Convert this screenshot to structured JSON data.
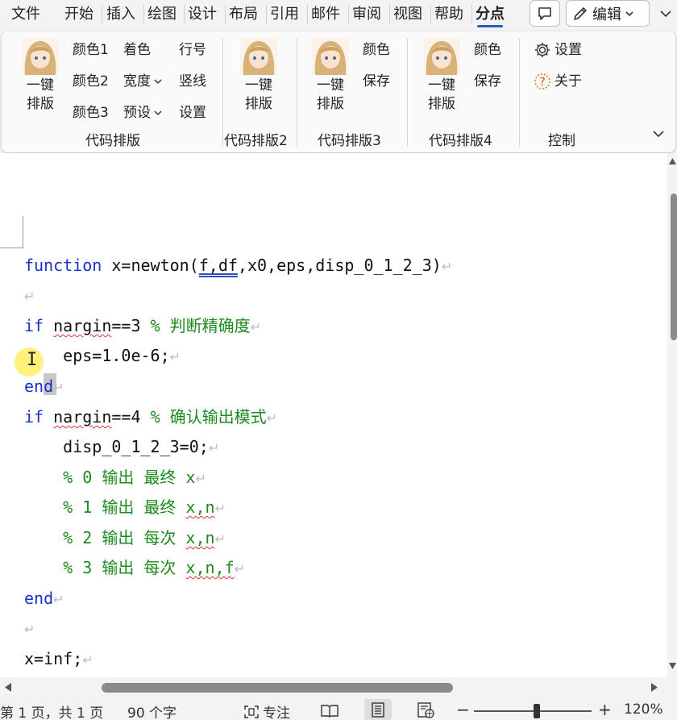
{
  "menu": {
    "tabs": [
      "文件",
      "开始",
      "插入",
      "绘图",
      "设计",
      "布局",
      "引用",
      "邮件",
      "审阅",
      "视图",
      "帮助",
      "分点"
    ],
    "active": "分点",
    "edit_label": "编辑"
  },
  "ribbon": {
    "groups": [
      {
        "label": "代码排版"
      },
      {
        "label": "代码排版2"
      },
      {
        "label": "代码排版3"
      },
      {
        "label": "代码排版4"
      },
      {
        "label": "控制"
      }
    ],
    "one_click_l1": "一键",
    "one_click_l2": "排版",
    "g1": {
      "color1": "颜色1",
      "color2": "颜色2",
      "color3": "颜色3",
      "tint": "着色",
      "width": "宽度",
      "preset": "预设",
      "lineno": "行号",
      "vline": "竖线",
      "settings": "设置"
    },
    "g3": {
      "color": "颜色",
      "save": "保存"
    },
    "g4": {
      "color": "颜色",
      "save": "保存"
    },
    "ctrl": {
      "settings": "设置",
      "about": "关于"
    }
  },
  "code": {
    "l1_kw": "function",
    "l1_a": " x=newton(",
    "l1_u": "f,df",
    "l1_b": ",x0,eps,disp_0_1_2_3)",
    "l3_kw": "if",
    "l3_w": "nargin",
    "l3_a": "==3 ",
    "l3_c": "% 判断精确度",
    "l4": "    eps=1.0e-6;",
    "l5_kw": "end",
    "l6_kw": "if",
    "l6_w": "nargin",
    "l6_a": "==4 ",
    "l6_c": "% 确认输出模式",
    "l7": "    disp_0_1_2_3=0;",
    "l8": "    % 0 输出 最终 x",
    "l9_a": "    % 1 输出 最终 ",
    "l9_w": "x,n",
    "l10_a": "    % 2 输出 每次 ",
    "l10_w": "x,n",
    "l11_a": "    % 3 输出 每次 ",
    "l11_w": "x,n,f",
    "l12_kw": "end",
    "l14": "x=inf;",
    "return_mark": "↵"
  },
  "status": {
    "page": "第 1 页，共 1 页",
    "words": "90 个字",
    "focus": "专注",
    "zoom_minus": "−",
    "zoom_plus": "+",
    "zoom": "120%"
  }
}
